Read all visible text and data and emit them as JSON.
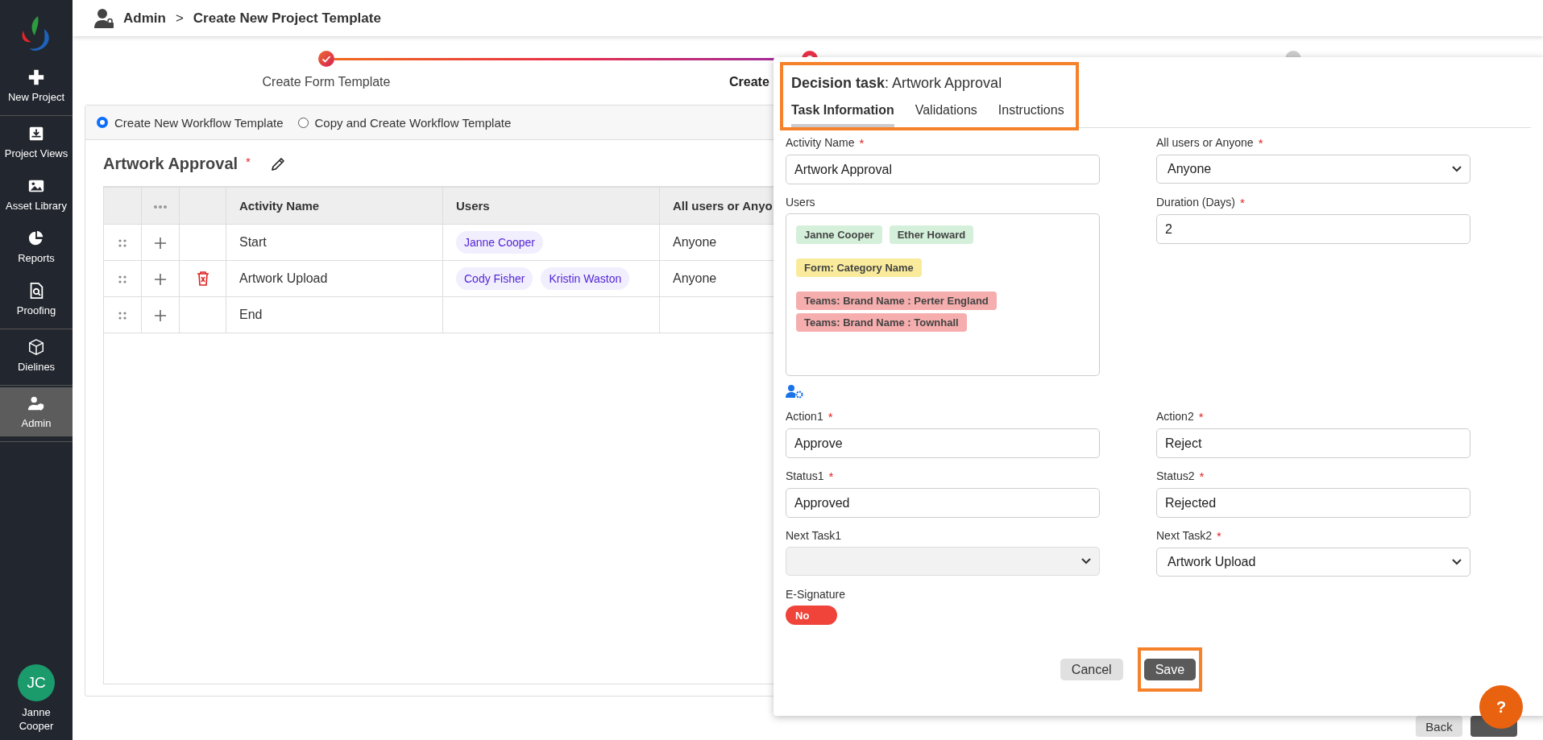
{
  "required_mark": "*",
  "sidebar": {
    "sections": [
      {
        "items": [
          {
            "label": "New Project",
            "selected": false
          }
        ]
      },
      {
        "items": [
          {
            "label": "Project Views",
            "selected": false
          },
          {
            "label": "Asset Library",
            "selected": false
          },
          {
            "label": "Reports",
            "selected": false
          },
          {
            "label": "Proofing",
            "selected": false
          }
        ]
      },
      {
        "items": [
          {
            "label": "Dielines",
            "selected": false
          }
        ]
      },
      {
        "items": [
          {
            "label": "Admin",
            "selected": true
          }
        ]
      }
    ],
    "user": {
      "initials": "JC",
      "name": "Janne Cooper"
    }
  },
  "header": {
    "breadcrumb": [
      "Admin",
      "Create New Project Template"
    ],
    "separator": ">"
  },
  "stepper": [
    {
      "label": "Create Form Template",
      "completed": true,
      "selected": false
    },
    {
      "label": "Create",
      "completed": false,
      "selected": true
    },
    {
      "completed": false,
      "selected": false
    }
  ],
  "template_options": [
    {
      "label": "Create New Workflow Template",
      "selected": true
    },
    {
      "label": "Copy and Create Workflow Template",
      "selected": false
    }
  ],
  "template": {
    "name": "Artwork Approval",
    "required": true
  },
  "table": {
    "columns": [
      "Activity Name",
      "Users",
      "All users or Anyo"
    ],
    "rows": [
      {
        "activity": "Start",
        "users": [
          "Janne Cooper"
        ],
        "assignment": "Anyone",
        "deletable": false
      },
      {
        "activity": "Artwork Upload",
        "users": [
          "Cody Fisher",
          "Kristin Waston"
        ],
        "assignment": "Anyone",
        "deletable": true
      },
      {
        "activity": "End",
        "users": [],
        "deletable": false
      }
    ]
  },
  "footer_buttons": [
    {
      "label": "Back",
      "kind": "secondary"
    },
    {
      "kind": "primary"
    }
  ],
  "panel": {
    "title": "**Decision task**: Artwork Approval",
    "header_highlighted": true,
    "tabs": [
      {
        "label": "Task Information",
        "selected": true
      },
      {
        "label": "Validations",
        "selected": false
      },
      {
        "label": "Instructions",
        "selected": false
      }
    ],
    "fields": [
      {
        "kind": "text",
        "label": "Activity Name",
        "required": true,
        "value": "Artwork Approval",
        "disabled": false
      },
      {
        "kind": "select",
        "label": "All users or Anyone",
        "required": true,
        "value": "Anyone",
        "disabled": false
      },
      {
        "kind": "users",
        "label": "Users",
        "required": false,
        "groups": [
          {
            "chips": [
              {
                "label": "Janne Cooper",
                "color": "#d4f0da"
              },
              {
                "label": "Ether Howard",
                "color": "#d4f0da"
              }
            ]
          },
          {
            "chips": [
              {
                "label": "Form: Category Name",
                "color": "#f9eb9b"
              }
            ]
          },
          {
            "chips": [
              {
                "label": "Teams: Brand Name : Perter England",
                "color": "#f5adad"
              },
              {
                "label": "Teams: Brand Name : Townhall",
                "color": "#f5adad"
              }
            ]
          }
        ]
      },
      {
        "kind": "text",
        "label": "Duration (Days)",
        "required": true,
        "value": "2",
        "disabled": false
      },
      {
        "kind": "text",
        "label": "Action1",
        "required": true,
        "value": "Approve",
        "disabled": false
      },
      {
        "kind": "text",
        "label": "Action2",
        "required": true,
        "value": "Reject",
        "disabled": false
      },
      {
        "kind": "text",
        "label": "Status1",
        "required": true,
        "value": "Approved",
        "disabled": false
      },
      {
        "kind": "text",
        "label": "Status2",
        "required": true,
        "value": "Rejected",
        "disabled": false
      },
      {
        "kind": "select",
        "label": "Next Task1",
        "required": false,
        "disabled": true
      },
      {
        "kind": "select",
        "label": "Next Task2",
        "required": true,
        "value": "Artwork Upload",
        "disabled": false
      },
      {
        "kind": "toggle",
        "label": "E-Signature",
        "required": false,
        "on": false,
        "text": "No"
      }
    ],
    "buttons": [
      {
        "label": "Cancel",
        "kind": "secondary",
        "highlighted": false
      },
      {
        "label": "Save",
        "kind": "primary",
        "highlighted": true
      }
    ]
  },
  "help": {
    "label": "?"
  }
}
